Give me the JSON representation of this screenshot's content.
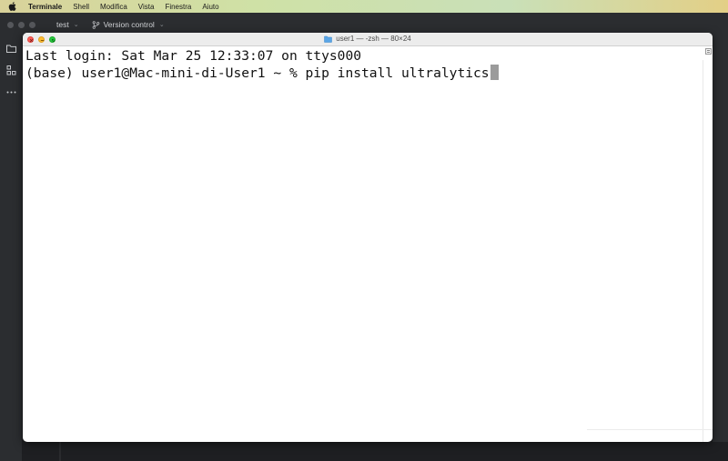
{
  "menubar": {
    "apple_icon": "apple-logo",
    "app_name": "Terminale",
    "items": [
      "Shell",
      "Modifica",
      "Vista",
      "Finestra",
      "Aiuto"
    ]
  },
  "ide": {
    "project": "test",
    "version_control": "Version control",
    "sidebar_icons": [
      "folder-icon",
      "structure-icon",
      "more-icon"
    ]
  },
  "terminal": {
    "title": "user1 — -zsh — 80×24",
    "lines": [
      "Last login: Sat Mar 25 12:33:07 on ttys000",
      "(base) user1@Mac-mini-di-User1 ~ % pip install ultralytics"
    ]
  },
  "colors": {
    "close": "#fe5f57",
    "minimize": "#febc2e",
    "maximize": "#28c840",
    "ide_bg": "#2b2d30",
    "terminal_bg": "#ffffff",
    "cursor": "#9b9b9b"
  }
}
